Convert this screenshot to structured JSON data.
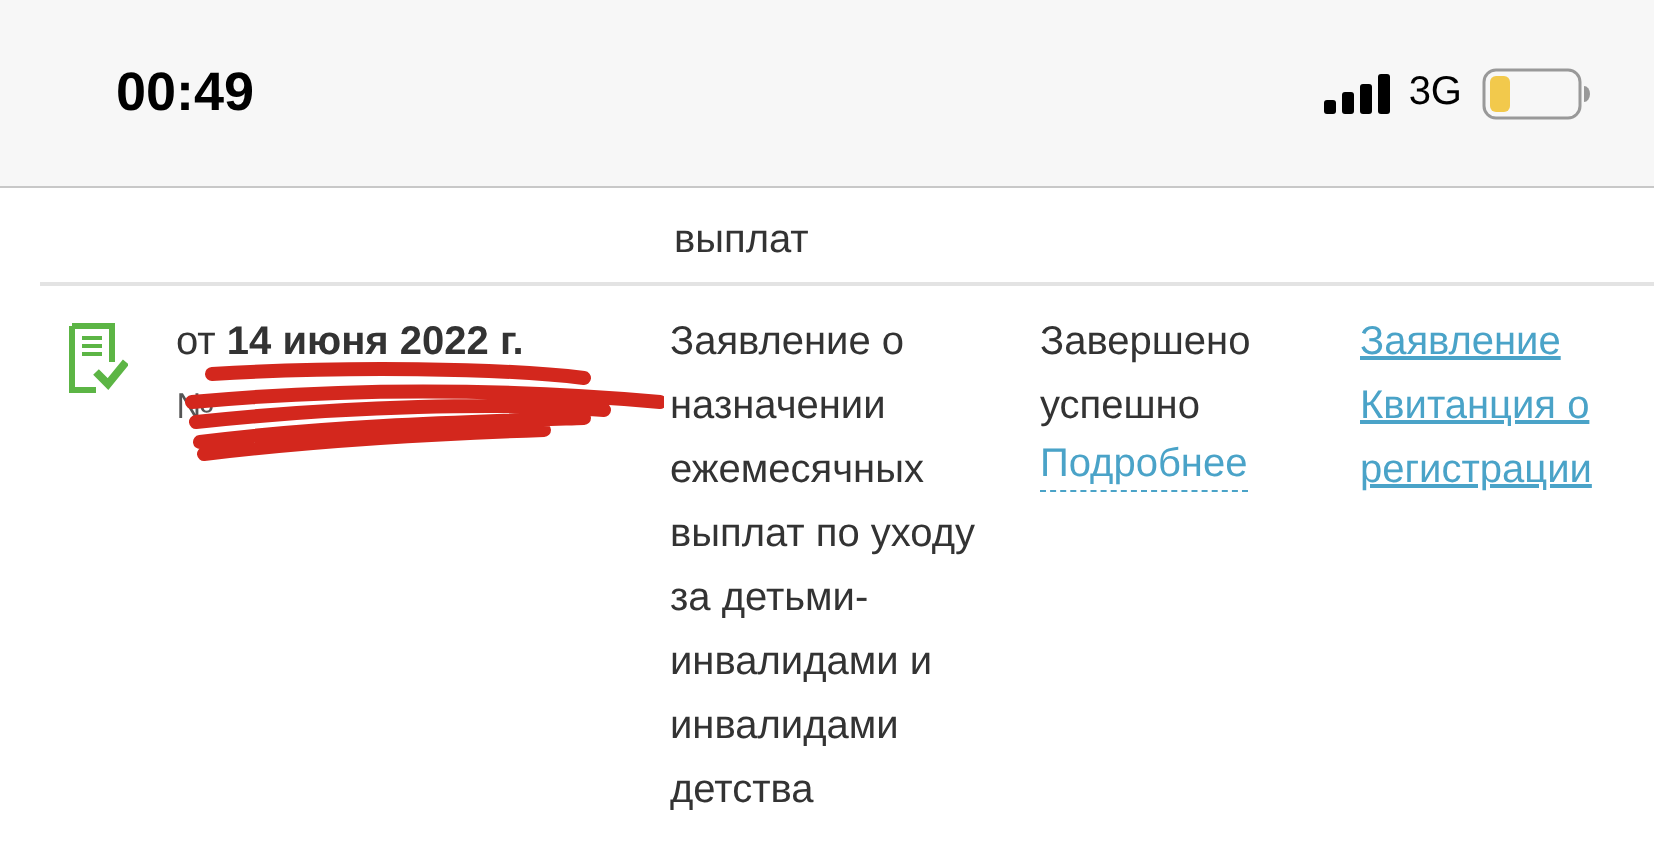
{
  "status_bar": {
    "time": "00:49",
    "network": "3G"
  },
  "previous_row": {
    "description_tail": "выплат"
  },
  "applications": [
    {
      "date": "от **14 июня 2022 г.**",
      "number": "№",
      "description": "Заявление о назначении ежемесячных выплат по уходу за детьми-инвалидами и инвалидами детства",
      "status": "Завершено успешно",
      "details_link": "Подробнее",
      "documents": [
        "Заявление",
        "Квитанция о регистрации"
      ]
    }
  ]
}
